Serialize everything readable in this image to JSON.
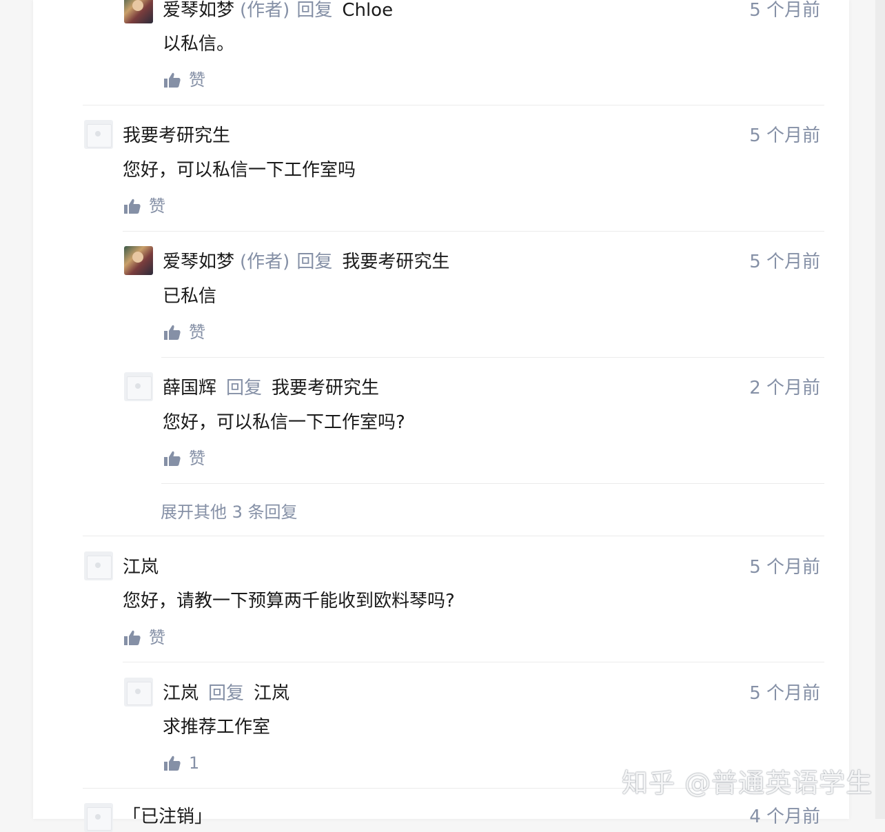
{
  "comments": [
    {
      "avatar": "photo",
      "name": "爱琴如梦",
      "author_tag": "(作者)",
      "reply_word": "回复",
      "reply_to": "Chloe",
      "time": "5 个月前",
      "content": "以私信。",
      "like": "赞"
    },
    {
      "avatar": "blank",
      "name": "我要考研究生",
      "time": "5 个月前",
      "content": "您好，可以私信一下工作室吗",
      "like": "赞"
    },
    {
      "avatar": "photo",
      "name": "爱琴如梦",
      "author_tag": "(作者)",
      "reply_word": "回复",
      "reply_to": "我要考研究生",
      "time": "5 个月前",
      "content": "已私信",
      "like": "赞"
    },
    {
      "avatar": "blank",
      "name": "薛国辉",
      "reply_word": "回复",
      "reply_to": "我要考研究生",
      "time": "2 个月前",
      "content": "您好，可以私信一下工作室吗?",
      "like": "赞"
    },
    {
      "avatar": "blank",
      "name": "江岚",
      "time": "5 个月前",
      "content": "您好，请教一下预算两千能收到欧料琴吗?",
      "like": "赞"
    },
    {
      "avatar": "blank",
      "name": "江岚",
      "reply_word": "回复",
      "reply_to": "江岚",
      "time": "5 个月前",
      "content": "求推荐工作室",
      "like": "1"
    },
    {
      "avatar": "blank",
      "name": "「已注销」",
      "time": "4 个月前"
    }
  ],
  "expand_replies": "展开其他 3 条回复",
  "watermark": "知乎 @普通英语学生",
  "icons": {
    "like": "thumbs-up-icon",
    "avatar_blank": "default-avatar-icon",
    "avatar_photo": "user-photo-avatar"
  }
}
